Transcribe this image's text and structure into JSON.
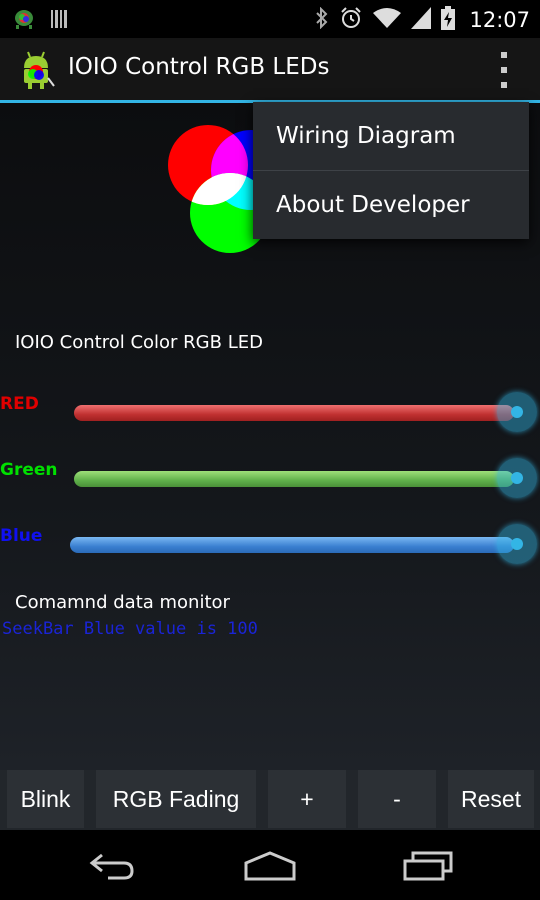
{
  "status_bar": {
    "time": "12:07",
    "icons": [
      "android-debug-icon",
      "barcode-icon",
      "bluetooth-icon",
      "alarm-icon",
      "wifi-icon",
      "signal-icon",
      "battery-charging-icon"
    ]
  },
  "action_bar": {
    "title": "IOIO Control RGB LEDs",
    "overflow_icon": "overflow-menu-icon"
  },
  "overflow_menu": {
    "items": [
      {
        "label": "Wiring Diagram"
      },
      {
        "label": "About Developer"
      }
    ]
  },
  "main": {
    "section_title": "IOIO Control Color RGB LED",
    "sliders": [
      {
        "label": "RED",
        "label_color": "#e00000",
        "value_fraction": 1.0
      },
      {
        "label": "Green",
        "label_color": "#00e000",
        "value_fraction": 1.0
      },
      {
        "label": "Blue",
        "label_color": "#1010f0",
        "value_fraction": 1.0
      }
    ],
    "monitor_title": "Comamnd data monitor",
    "monitor_output": "SeekBar Blue value is 100"
  },
  "buttons": [
    {
      "label": "Blink"
    },
    {
      "label": "RGB Fading"
    },
    {
      "label": "+"
    },
    {
      "label": "-"
    },
    {
      "label": "Reset"
    }
  ],
  "nav_bar": {
    "icons": [
      "back-icon",
      "home-icon",
      "recent-apps-icon"
    ]
  },
  "colors": {
    "accent": "#33b5e5",
    "red": "#ff0000",
    "green": "#00ff00",
    "blue": "#0000ff"
  }
}
